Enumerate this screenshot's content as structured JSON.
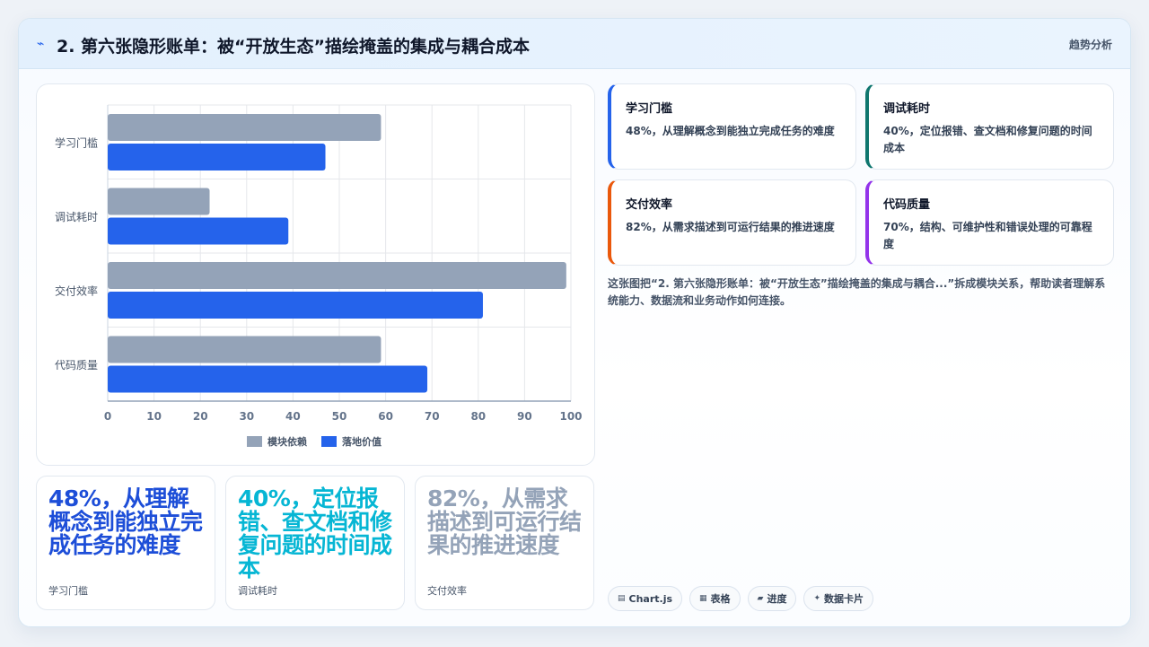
{
  "header": {
    "icon": "trend-icon",
    "title": "2. 第六张隐形账单：被“开放生态”描绘掩盖的集成与耦合成本",
    "tag": "趋势分析"
  },
  "colors": {
    "series_gray": "#94a3b8",
    "series_blue": "#2563eb",
    "metric_blue": "#1d4ed8",
    "metric_cyan": "#06b6d4",
    "metric_gray": "#94a3b8",
    "border_blue": "#2563eb",
    "border_teal": "#0f766e",
    "border_orange": "#ea580c",
    "border_purple": "#9333ea"
  },
  "chart_data": {
    "type": "bar",
    "orientation": "horizontal",
    "categories": [
      "学习门槛",
      "调试耗时",
      "交付效率",
      "代码质量"
    ],
    "series": [
      {
        "name": "模块依赖",
        "values": [
          59,
          22,
          99,
          59
        ]
      },
      {
        "name": "落地价值",
        "values": [
          47,
          39,
          81,
          69
        ]
      }
    ],
    "xlim": [
      0,
      100
    ],
    "xticks": [
      0,
      10,
      20,
      30,
      40,
      50,
      60,
      70,
      80,
      90,
      100
    ],
    "grid": true,
    "legend": "bottom"
  },
  "metrics": [
    {
      "value": "48%，从理解概念到能独立完成任务的难度",
      "caption": "学习门槛"
    },
    {
      "value": "40%，定位报错、查文档和修复问题的时间成本",
      "caption": "调试耗时"
    },
    {
      "value": "82%，从需求描述到可运行结果的推进速度",
      "caption": "交付效率"
    }
  ],
  "cards": [
    {
      "title": "学习门槛",
      "desc": "48%，从理解概念到能独立完成任务的难度"
    },
    {
      "title": "调试耗时",
      "desc": "40%，定位报错、查文档和修复问题的时间成本"
    },
    {
      "title": "交付效率",
      "desc": "82%，从需求描述到可运行结果的推进速度"
    },
    {
      "title": "代码质量",
      "desc": "70%，结构、可维护性和错误处理的可靠程度"
    }
  ],
  "description": "这张图把“2. 第六张隐形账单：被“开放生态”描绘掩盖的集成与耦合...”拆成模块关系，帮助读者理解系统能力、数据流和业务动作如何连接。",
  "chips": [
    {
      "icon": "▤",
      "label": "Chart.js"
    },
    {
      "icon": "▦",
      "label": "表格"
    },
    {
      "icon": "▰",
      "label": "进度"
    },
    {
      "icon": "✦",
      "label": "数据卡片"
    }
  ]
}
